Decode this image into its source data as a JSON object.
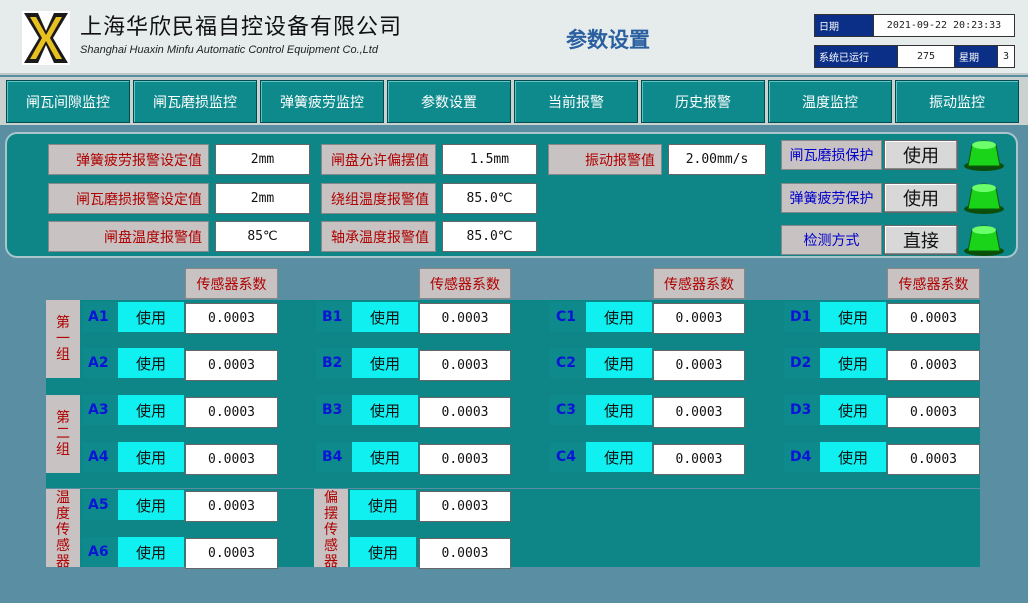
{
  "header": {
    "company_cn": "上海华欣民福自控设备有限公司",
    "company_en": "Shanghai Huaxin Minfu Automatic Control Equipment Co.,Ltd",
    "page_title": "参数设置",
    "date_label": "日期",
    "datetime": "2021-09-22 20:23:33",
    "runtime_label": "系统已运行",
    "runtime_value": "275",
    "week_label": "星期",
    "week_value": "3"
  },
  "nav": [
    "闸瓦间隙监控",
    "闸瓦磨损监控",
    "弹簧疲劳监控",
    "参数设置",
    "当前报警",
    "历史报警",
    "温度监控",
    "振动监控"
  ],
  "params": {
    "spring_alarm_label": "弹簧疲劳报警设定值",
    "spring_alarm_value": "2mm",
    "shoe_wear_label": "闸瓦磨损报警设定值",
    "shoe_wear_value": "2mm",
    "disc_temp_label": "闸盘温度报警值",
    "disc_temp_value": "85℃",
    "disc_swing_label": "闸盘允许偏摆值",
    "disc_swing_value": "1.5mm",
    "winding_temp_label": "绕组温度报警值",
    "winding_temp_value": "85.0℃",
    "bearing_temp_label": "轴承温度报警值",
    "bearing_temp_value": "85.0℃",
    "vibration_label": "振动报警值",
    "vibration_value": "2.00mm/s",
    "shoe_protect_label": "闸瓦磨损保护",
    "shoe_protect_btn": "使用",
    "spring_protect_label": "弹簧疲劳保护",
    "spring_protect_btn": "使用",
    "detect_mode_label": "检测方式",
    "detect_mode_btn": "直接",
    "lamp_color": "#19d419"
  },
  "sensors": {
    "coef_header": "传感器系数",
    "group1_label": "第一组",
    "group2_label": "第二组",
    "temp_label": "温度传感器",
    "swing_label": "偏摆传感器",
    "use_text": "使用",
    "rows": [
      [
        {
          "ch": "A1",
          "v": "0.0003"
        },
        {
          "ch": "B1",
          "v": "0.0003"
        },
        {
          "ch": "C1",
          "v": "0.0003"
        },
        {
          "ch": "D1",
          "v": "0.0003"
        }
      ],
      [
        {
          "ch": "A2",
          "v": "0.0003"
        },
        {
          "ch": "B2",
          "v": "0.0003"
        },
        {
          "ch": "C2",
          "v": "0.0003"
        },
        {
          "ch": "D2",
          "v": "0.0003"
        }
      ],
      [
        {
          "ch": "A3",
          "v": "0.0003"
        },
        {
          "ch": "B3",
          "v": "0.0003"
        },
        {
          "ch": "C3",
          "v": "0.0003"
        },
        {
          "ch": "D3",
          "v": "0.0003"
        }
      ],
      [
        {
          "ch": "A4",
          "v": "0.0003"
        },
        {
          "ch": "B4",
          "v": "0.0003"
        },
        {
          "ch": "C4",
          "v": "0.0003"
        },
        {
          "ch": "D4",
          "v": "0.0003"
        }
      ]
    ],
    "temp_rows": [
      {
        "ch": "A5",
        "v": "0.0003"
      },
      {
        "ch": "A6",
        "v": "0.0003"
      }
    ],
    "swing_rows": [
      {
        "v": "0.0003"
      },
      {
        "v": "0.0003"
      }
    ]
  }
}
